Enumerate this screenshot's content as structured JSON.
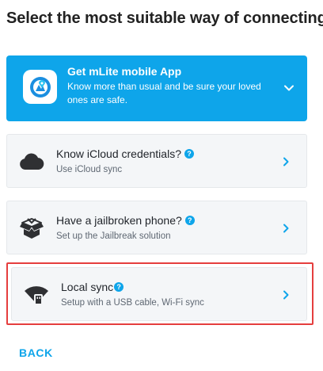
{
  "title": "Select the most suitable way of connecting",
  "promo": {
    "title": "Get mLite mobile App",
    "description": "Know more than usual and be sure your loved ones are safe.",
    "icon": "mlite-app-logo",
    "expand_icon": "chevron-down-icon",
    "background": "#0ea5ea"
  },
  "options": [
    {
      "title": "Know iCloud credentials?",
      "subtitle": "Use iCloud sync",
      "icon": "cloud-icon",
      "help_icon": "?"
    },
    {
      "title": "Have a jailbroken phone?",
      "subtitle": "Set up the Jailbreak solution",
      "icon": "open-box-icon",
      "help_icon": "?"
    },
    {
      "title": "Local sync",
      "subtitle": "Setup with a USB cable, Wi-Fi sync",
      "icon": "wifi-usb-icon",
      "help_icon": "?",
      "selected": true
    }
  ],
  "back_label": "BACK",
  "colors": {
    "accent": "#0ea5ea",
    "highlight": "#e53e3e",
    "card_bg": "#f4f6f8"
  }
}
